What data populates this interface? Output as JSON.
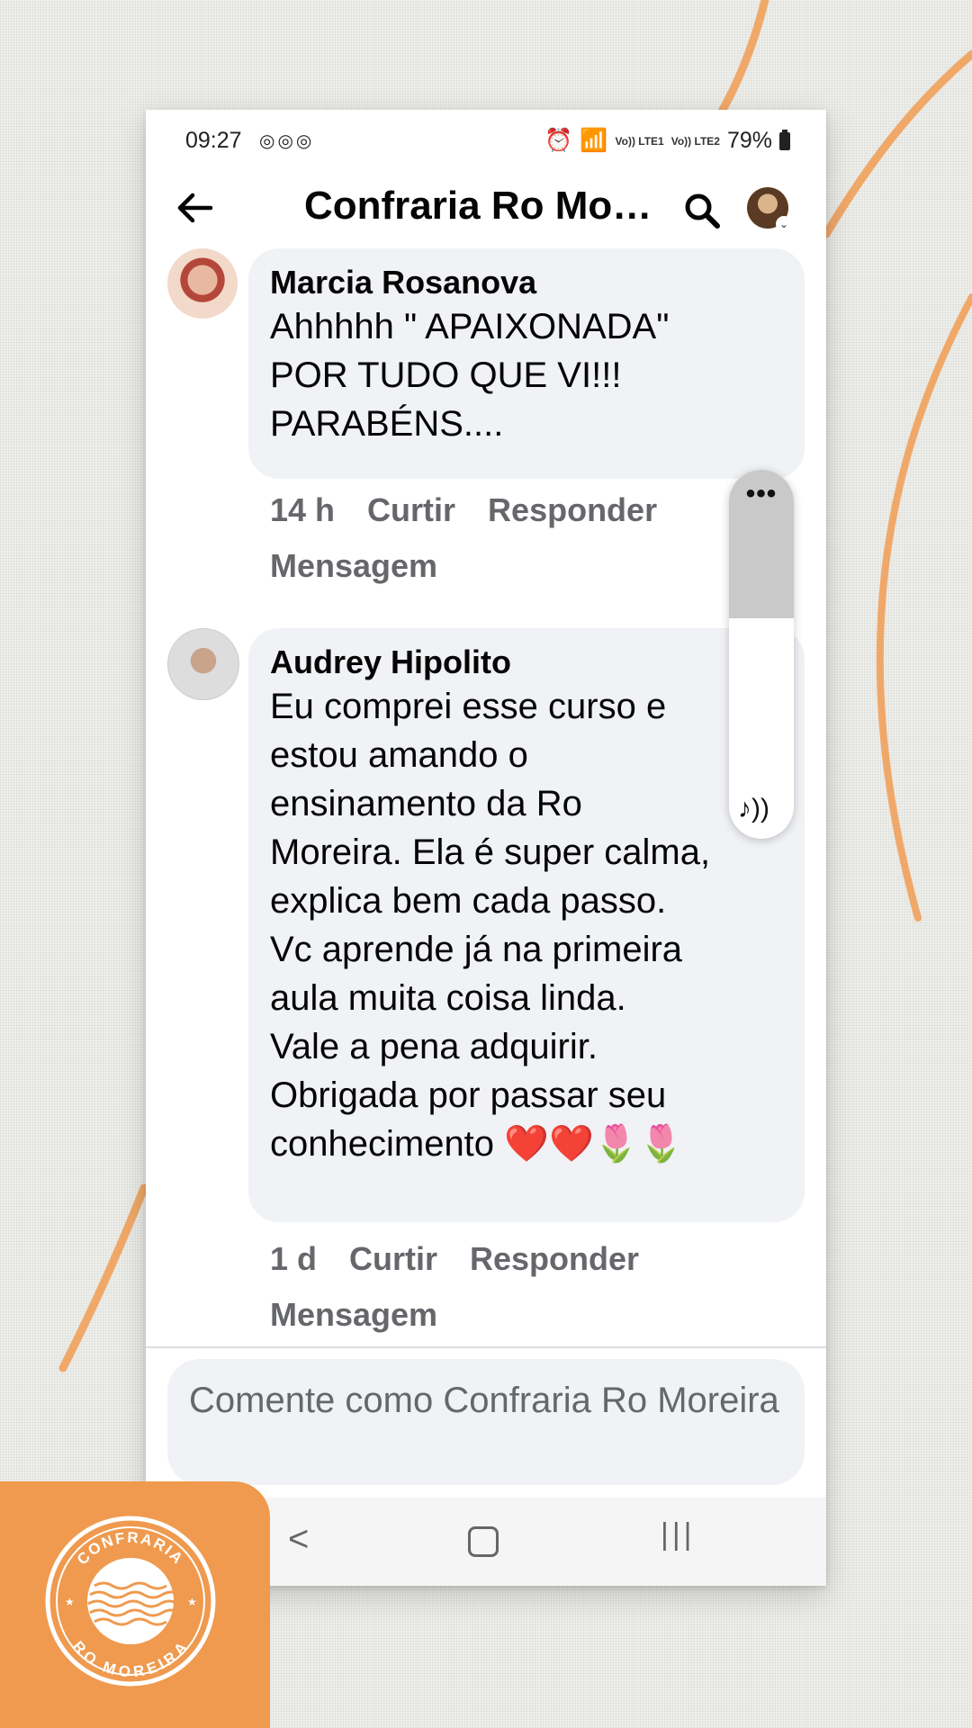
{
  "status_bar": {
    "time": "09:27",
    "app_icons": "◎◎◎",
    "network1": "Vo)) LTE1",
    "network2": "Vo)) LTE2",
    "battery": "79%"
  },
  "header": {
    "title": "Confraria Ro Mo…"
  },
  "comments": [
    {
      "author": "Marcia Rosanova",
      "text": "Ahhhhh   \" APAIXONADA\"\nPOR TUDO QUE VI!!!\nPARABÉNS....",
      "time": "14 h",
      "like": "Curtir",
      "reply": "Responder",
      "message": "Mensagem"
    },
    {
      "author": "Audrey Hipolito",
      "text": "Eu comprei esse curso e\nestou amando o\nensinamento da Ro\nMoreira. Ela é super calma,\nexplica bem cada passo.\nVc aprende já na primeira\naula muita coisa linda.\nVale a pena adquirir.\nObrigada por passar seu\nconhecimento ❤️❤️🌷🌷",
      "time": "1 d",
      "like": "Curtir",
      "reply": "Responder",
      "message": "Mensagem"
    }
  ],
  "overlay": {
    "menu": "•••",
    "sound": "♪))"
  },
  "composer": {
    "placeholder": "Comente como Confraria Ro Moreira"
  },
  "navbar": {
    "back": "<",
    "recent": "|||"
  },
  "logo": {
    "top_text": "CONFRARIA",
    "bottom_text": "RO MOREIRA"
  },
  "colors": {
    "accent_orange": "#ef9a4e",
    "bubble_bg": "#f0f2f5",
    "meta_gray": "#65676b"
  }
}
